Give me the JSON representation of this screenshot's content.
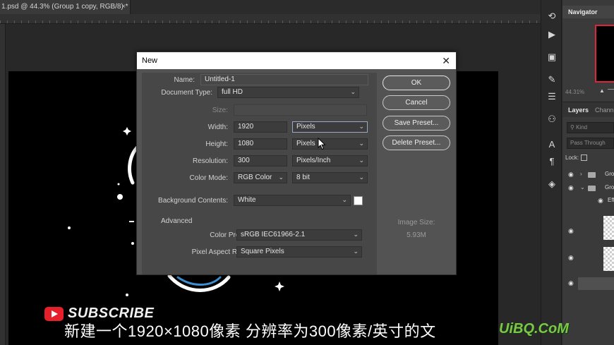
{
  "document_tab": {
    "title": "1.psd @ 44.3% (Group 1 copy, RGB/8) *",
    "close_glyph": "×"
  },
  "navigator": {
    "title": "Navigator",
    "zoom": "44.31%"
  },
  "layers_panel": {
    "tab_layers": "Layers",
    "tab_channels": "Chann",
    "kind_placeholder": "Kind",
    "blend_mode": "Pass Through",
    "lock_label": "Lock:",
    "rows": [
      {
        "name": "Gro"
      },
      {
        "name": "Gro"
      },
      {
        "name": "Eff"
      }
    ]
  },
  "dialog": {
    "title": "New",
    "close_glyph": "✕",
    "name_label": "Name:",
    "name_value": "Untitled-1",
    "doctype_label": "Document Type:",
    "doctype_value": "full HD",
    "size_label": "Size:",
    "size_value": "",
    "width_label": "Width:",
    "width_value": "1920",
    "width_unit": "Pixels",
    "height_label": "Height:",
    "height_value": "1080",
    "height_unit": "Pixels",
    "resolution_label": "Resolution:",
    "resolution_value": "300",
    "resolution_unit": "Pixels/Inch",
    "colormode_label": "Color Mode:",
    "colormode_value": "RGB Color",
    "bitdepth_value": "8 bit",
    "bg_label": "Background Contents:",
    "bg_value": "White",
    "advanced_label": "Advanced",
    "profile_label": "Color Profile:",
    "profile_value": "sRGB IEC61966-2.1",
    "aspect_label": "Pixel Aspect Ratio:",
    "aspect_value": "Square Pixels",
    "image_size_label": "Image Size:",
    "image_size_value": "5.93M",
    "buttons": {
      "ok": "OK",
      "cancel": "Cancel",
      "save_preset": "Save Preset...",
      "delete_preset": "Delete Preset..."
    }
  },
  "overlay": {
    "subscribe": "SUBSCRIBE",
    "caption": "新建一个1920×1080像素 分辨率为300像素/英寸的文",
    "watermark": "UiBQ.CoM"
  },
  "colors": {
    "accent_red": "#d9263a",
    "youtube_red": "#e5202a",
    "watermark_green": "#7ec64a"
  }
}
